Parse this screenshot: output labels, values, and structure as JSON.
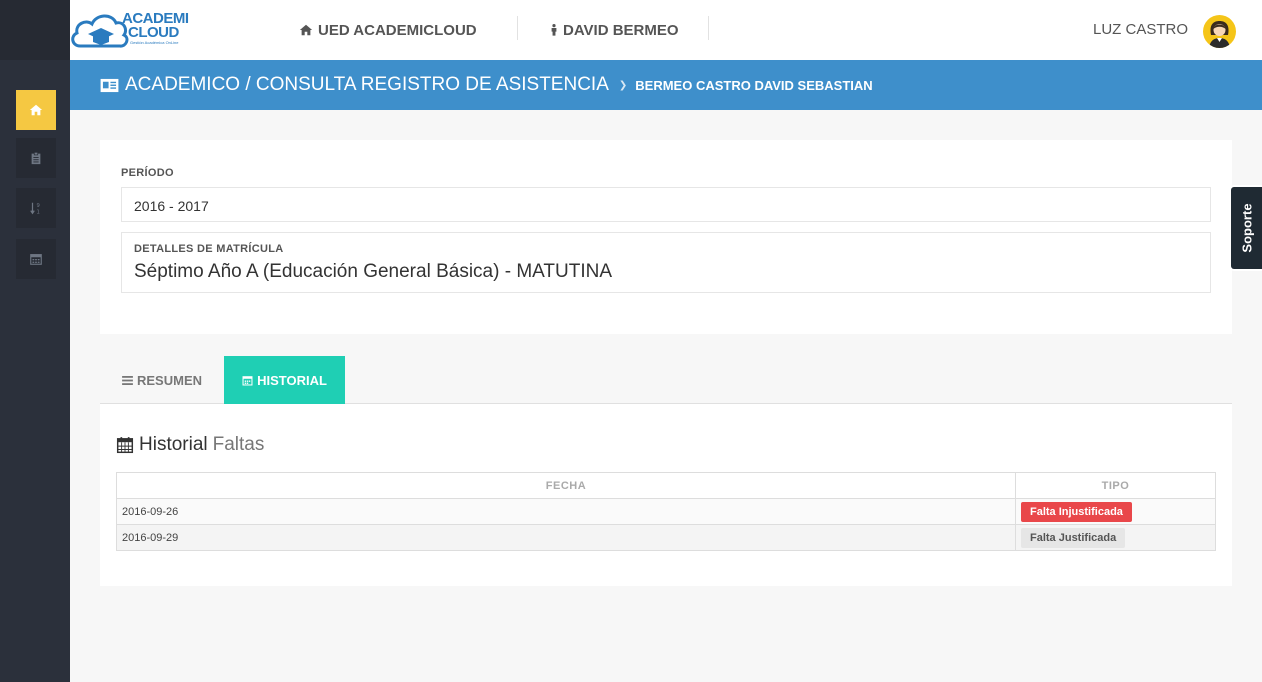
{
  "header": {
    "logo_line1": "ACADEMI",
    "logo_line2": "CLOUD",
    "logo_sub": "Gestión Académica OnLine",
    "institution": "UED ACADEMICLOUD",
    "student": "DAVID BERMEO",
    "user": "LUZ CASTRO"
  },
  "sidebar": {
    "items": [
      {
        "icon": "home-icon",
        "active": true
      },
      {
        "icon": "clipboard-icon",
        "active": false
      },
      {
        "icon": "sort-numeric-icon",
        "active": false
      },
      {
        "icon": "calendar-icon",
        "active": false
      }
    ]
  },
  "titlebar": {
    "title": "ACADEMICO / CONSULTA REGISTRO DE ASISTENCIA",
    "student": "BERMEO CASTRO DAVID SEBASTIAN"
  },
  "periodo": {
    "label": "PERÍODO",
    "value": "2016 - 2017"
  },
  "matricula": {
    "label": "DETALLES DE MATRÍCULA",
    "value": "Séptimo Año A (Educación General Básica) - MATUTINA"
  },
  "soporte": "Soporte",
  "tabs": [
    {
      "label": "RESUMEN",
      "icon": "bars-icon",
      "active": false
    },
    {
      "label": "HISTORIAL",
      "icon": "calendar-icon",
      "active": true
    }
  ],
  "historial": {
    "title": "Historial",
    "subtitle": "Faltas",
    "columns": [
      "FECHA",
      "TIPO"
    ],
    "rows": [
      {
        "fecha": "2016-09-26",
        "tipo": "Falta Injustificada",
        "color": "#e9474a"
      },
      {
        "fecha": "2016-09-29",
        "tipo": "Falta Justificada",
        "color": "#e6e6e6"
      }
    ]
  }
}
